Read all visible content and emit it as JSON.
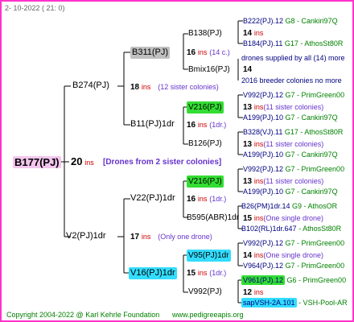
{
  "header": {
    "date": "2- 10-2022 ( 21: 0)"
  },
  "footer": {
    "copyright": "Copyright 2004-2022 @ Karl Kehrle Foundation",
    "site": "www.pedigreeapis.org"
  },
  "root": {
    "name": "B177(PJ)",
    "ins_num": "20",
    "ins": "ins",
    "note": "[Drones from 2 sister colonies]"
  },
  "gen1": [
    {
      "name": "B274(PJ)",
      "ins_num": "18",
      "ins": "ins",
      "note": "(12 sister colonies)"
    },
    {
      "name": "V2(PJ)1dr",
      "ins_num": "17",
      "ins": "ins",
      "note": "(Only one drone)"
    }
  ],
  "gen2": [
    {
      "name": "B311(PJ)",
      "ins_num": "16",
      "ins": "ins",
      "note": "(14 c.)"
    },
    {
      "name": "B11(PJ)1dr",
      "ins_num": "16",
      "ins": "ins",
      "note": "(1dr.)"
    },
    {
      "name": "V22(PJ)1dr",
      "ins_num": "16",
      "ins": "ins",
      "note": "(1dr.)"
    },
    {
      "name": "V16(PJ)1dr",
      "ins_num": "15",
      "ins": "ins",
      "note": "(1dr.)"
    }
  ],
  "gen3": [
    {
      "name": "B138(PJ)",
      "ins_num": "14",
      "ins": "ins"
    },
    {
      "name": "Bmix16(PJ)",
      "ins_num": "14",
      "ins": ""
    },
    {
      "name": "V216(PJ)",
      "ins_num": "13",
      "ins": "ins",
      "note": "(11 sister colonies)"
    },
    {
      "name": "B126(PJ)",
      "ins_num": "13",
      "ins": "ins",
      "note": "(11 sister colonies)"
    },
    {
      "name": "V216(PJ)",
      "ins_num": "13",
      "ins": "ins",
      "note": "(11 sister colonies)"
    },
    {
      "name": "B595(ABR)1dr",
      "ins_num": "15",
      "ins": "ins",
      "note": "(One single drone)"
    },
    {
      "name": "V95(PJ)1dr",
      "ins_num": "14",
      "ins": "ins",
      "note": "(One single drone)"
    },
    {
      "name": "V992(PJ)",
      "ins_num": "12",
      "ins": "ins"
    }
  ],
  "gen4": [
    {
      "name": "B222(PJ).12",
      "loc": "G8 - Cankiri97Q"
    },
    {
      "name": "B184(PJ).11",
      "loc": "G17 - AthosSt80R"
    },
    {
      "name": "drones supplied by all (14) more",
      "loc": ""
    },
    {
      "name": "2016 breeder colonies no more",
      "loc": ""
    },
    {
      "name": "V992(PJ).12",
      "loc": "G7 - PrimGreen00"
    },
    {
      "name": "A199(PJ).10",
      "loc": "G7 - Cankiri97Q"
    },
    {
      "name": "B328(VJ).11",
      "loc": "G17 - AthosSt80R"
    },
    {
      "name": "A199(PJ).10",
      "loc": "G7 - Cankiri97Q"
    },
    {
      "name": "V992(PJ).12",
      "loc": "G7 - PrimGreen00"
    },
    {
      "name": "A199(PJ).10",
      "loc": "G7 - Cankiri97Q"
    },
    {
      "name": "B26(PM)1dr.14",
      "loc": "G9 - AthosOR"
    },
    {
      "name": "B102(RL)1dr.647",
      "loc": "- AthosSt80R"
    },
    {
      "name": "V992(PJ).12",
      "loc": "G7 - PrimGreen00"
    },
    {
      "name": "V964(PJ).12",
      "loc": "G7 - PrimGreen00"
    },
    {
      "name": "V961(PJ).12",
      "loc": "G6 - PrimGreen00"
    },
    {
      "name": "sapVSH-2A.101",
      "loc": "- VSH-Pool-AR"
    }
  ]
}
